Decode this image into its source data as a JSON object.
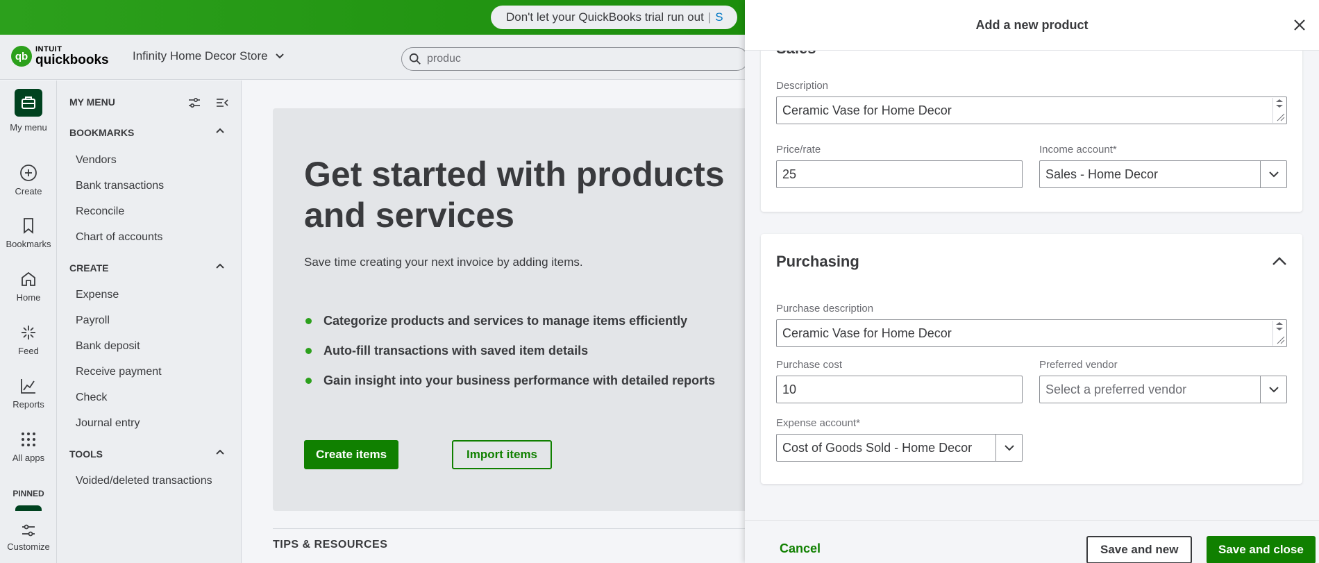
{
  "banner": {
    "text": "Don't let your QuickBooks trial run out",
    "link": "S"
  },
  "header": {
    "logo_top": "INTUIT",
    "logo_bottom": "quickbooks",
    "company_name": "Infinity Home Decor Store",
    "search_value": "produc"
  },
  "rail": {
    "items": [
      {
        "label": "My menu",
        "icon": "briefcase-icon"
      },
      {
        "label": "Create",
        "icon": "plus-circle-icon"
      },
      {
        "label": "Bookmarks",
        "icon": "bookmark-icon"
      },
      {
        "label": "Home",
        "icon": "home-icon"
      },
      {
        "label": "Feed",
        "icon": "sparkle-icon"
      },
      {
        "label": "Reports",
        "icon": "chart-line-icon"
      },
      {
        "label": "All apps",
        "icon": "grid-icon"
      }
    ],
    "pinned_label": "PINNED",
    "customize_label": "Customize"
  },
  "menu": {
    "title": "MY MENU",
    "sections": [
      {
        "title": "BOOKMARKS",
        "items": [
          "Vendors",
          "Bank transactions",
          "Reconcile",
          "Chart of accounts"
        ]
      },
      {
        "title": "CREATE",
        "items": [
          "Expense",
          "Payroll",
          "Bank deposit",
          "Receive payment",
          "Check",
          "Journal entry"
        ]
      },
      {
        "title": "TOOLS",
        "items": [
          "Voided/deleted transactions"
        ]
      }
    ]
  },
  "hero": {
    "title": "Get started with products and services",
    "subtitle": "Save time creating your next invoice by adding items.",
    "bullets": [
      "Categorize products and services to manage items efficiently",
      "Auto-fill transactions with saved item details",
      "Gain insight into your business performance with detailed reports"
    ],
    "create_button": "Create items",
    "import_button": "Import items",
    "tips_heading": "TIPS & RESOURCES"
  },
  "drawer": {
    "title": "Add a new product",
    "sales": {
      "title": "Sales",
      "description_label": "Description",
      "description_value": "Ceramic Vase for Home Decor",
      "price_label": "Price/rate",
      "price_value": "25",
      "income_label": "Income account*",
      "income_value": "Sales - Home Decor"
    },
    "purchasing": {
      "title": "Purchasing",
      "description_label": "Purchase description",
      "description_value": "Ceramic Vase for Home Decor",
      "cost_label": "Purchase cost",
      "cost_value": "10",
      "vendor_label": "Preferred vendor",
      "vendor_placeholder": "Select a preferred vendor",
      "expense_label": "Expense account*",
      "expense_value": "Cost of Goods Sold - Home Decor"
    },
    "footer": {
      "cancel": "Cancel",
      "save_new": "Save and new",
      "save_close": "Save and close"
    }
  },
  "colors": {
    "brand_green": "#2ca01c",
    "dark_green": "#108000",
    "nav_active": "#00421f"
  }
}
